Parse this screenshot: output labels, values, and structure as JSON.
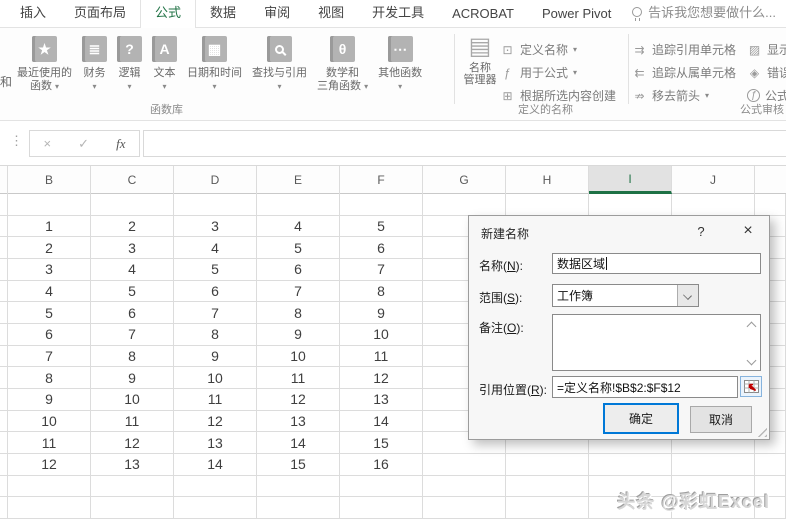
{
  "tabbar": {
    "tabs": [
      "插入",
      "页面布局",
      "公式",
      "数据",
      "审阅",
      "视图",
      "开发工具",
      "ACROBAT",
      "Power Pivot"
    ],
    "active_tab": "公式",
    "tell_me": "告诉我您想要做什么..."
  },
  "ribbon": {
    "partial_left": "和",
    "function_library": {
      "label": "函数库",
      "buttons": [
        {
          "name": "recent-functions",
          "icon": "book-star",
          "glyph": "★",
          "lines": [
            "最近使用的",
            "函数"
          ],
          "arrow": true
        },
        {
          "name": "financial",
          "icon": "book-coins",
          "glyph": "≣",
          "lines": [
            "财务"
          ],
          "arrow": true
        },
        {
          "name": "logical",
          "icon": "book-question",
          "glyph": "?",
          "lines": [
            "逻辑"
          ],
          "arrow": true
        },
        {
          "name": "text",
          "icon": "book-a",
          "glyph": "A",
          "lines": [
            "文本"
          ],
          "arrow": true
        },
        {
          "name": "date-time",
          "icon": "book-calendar",
          "glyph": "▦",
          "lines": [
            "日期和时间"
          ],
          "arrow": true
        },
        {
          "name": "lookup-reference",
          "icon": "book-magnifier",
          "glyph": "",
          "lines": [
            "查找与引用"
          ],
          "arrow": true
        },
        {
          "name": "math-trig",
          "icon": "book-theta",
          "glyph": "θ",
          "lines": [
            "数学和",
            "三角函数"
          ],
          "arrow": true
        },
        {
          "name": "more-functions",
          "icon": "book-ellipsis",
          "glyph": "⋯",
          "lines": [
            "其他函数"
          ],
          "arrow": true
        }
      ]
    },
    "defined_names": {
      "label": "定义的名称",
      "manager_icon": "▤",
      "manager_line1": "名称",
      "manager_line2": "管理器",
      "items": [
        {
          "name": "define-name",
          "icon": "tag",
          "glyph": "⊡",
          "label": "定义名称",
          "arrow": true
        },
        {
          "name": "use-in-formula",
          "icon": "fx-pen",
          "glyph": "ƒ",
          "label": "用于公式",
          "arrow": true
        },
        {
          "name": "create-from-selection",
          "icon": "grid",
          "glyph": "⊞",
          "label": "根据所选内容创建",
          "arrow": false
        }
      ]
    },
    "formula_auditing": {
      "label": "公式审核",
      "items": [
        {
          "name": "trace-precedents",
          "icon": "trace-precedents",
          "glyph": "⇉",
          "label": "追踪引用单元格",
          "arrow": false
        },
        {
          "name": "trace-dependents",
          "icon": "trace-dependents",
          "glyph": "⇇",
          "label": "追踪从属单元格",
          "arrow": false
        },
        {
          "name": "remove-arrows",
          "icon": "remove-arrows",
          "glyph": "⇏",
          "label": "移去箭头",
          "arrow": true
        }
      ],
      "items_right": [
        {
          "name": "show-formulas",
          "icon": "show-formulas",
          "glyph": "▨",
          "label": "显示"
        },
        {
          "name": "error-checking",
          "icon": "error-checking",
          "glyph": "◈",
          "label": "错误"
        },
        {
          "name": "evaluate-formula",
          "icon": "evaluate-formula",
          "glyph": "ƒ",
          "label": "公式"
        }
      ]
    }
  },
  "formula_bar": {
    "cancel": "×",
    "enter": "✓",
    "fx": "fx",
    "handle": "⋮",
    "value": ""
  },
  "grid": {
    "columns": [
      "B",
      "C",
      "D",
      "E",
      "F",
      "G",
      "H",
      "I",
      "J"
    ],
    "selected_column": "I",
    "rows": [
      [
        1,
        2,
        3,
        4,
        5
      ],
      [
        2,
        3,
        4,
        5,
        6
      ],
      [
        3,
        4,
        5,
        6,
        7
      ],
      [
        4,
        5,
        6,
        7,
        8
      ],
      [
        5,
        6,
        7,
        8,
        9
      ],
      [
        6,
        7,
        8,
        9,
        10
      ],
      [
        7,
        8,
        9,
        10,
        11
      ],
      [
        8,
        9,
        10,
        11,
        12
      ],
      [
        9,
        10,
        11,
        12,
        13
      ],
      [
        10,
        11,
        12,
        13,
        14
      ],
      [
        11,
        12,
        13,
        14,
        15
      ],
      [
        12,
        13,
        14,
        15,
        16
      ]
    ]
  },
  "dialog": {
    "title": "新建名称",
    "help": "?",
    "close": "×",
    "name_label": {
      "pre": "名称(",
      "key": "N",
      "suf": "):"
    },
    "name_value": "数据区域",
    "scope_label": {
      "pre": "范围(",
      "key": "S",
      "suf": "):"
    },
    "scope_value": "工作簿",
    "comment_label": {
      "pre": "备注(",
      "key": "O",
      "suf": "):"
    },
    "comment_value": "",
    "refers_label": {
      "pre": "引用位置(",
      "key": "R",
      "suf": "):"
    },
    "refers_value": "=定义名称!$B$2:$F$12",
    "ok": "确定",
    "cancel": "取消"
  },
  "watermark": {
    "text": "头条 @彩虹Excel"
  },
  "colors": {
    "accent_green": "#217346",
    "accent_blue": "#0078d7",
    "header_select": "#e2e2e2"
  }
}
